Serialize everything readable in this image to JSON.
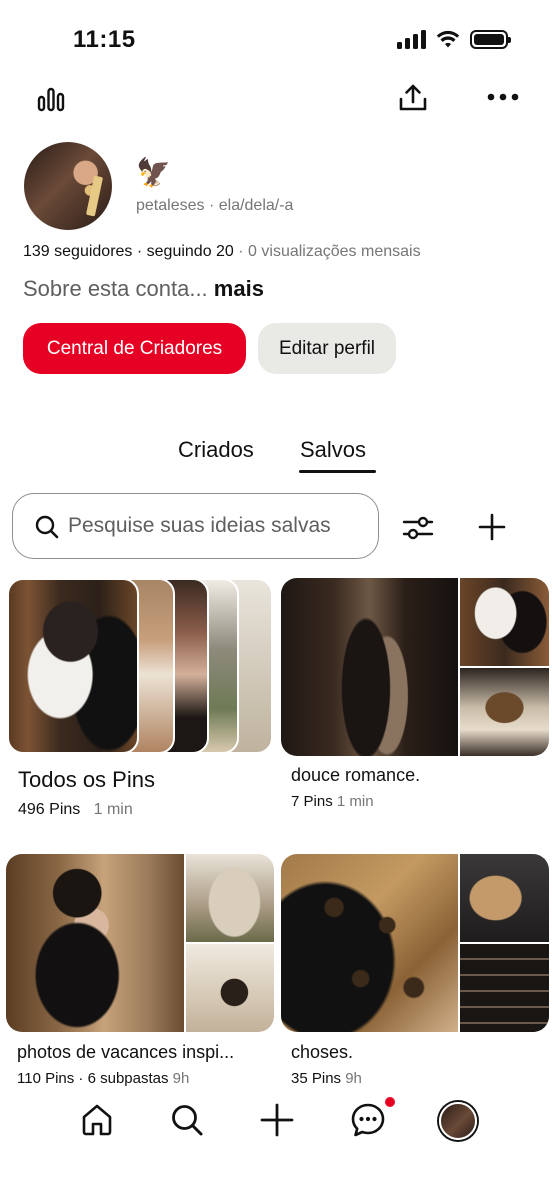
{
  "status_bar": {
    "time": "11:15"
  },
  "profile": {
    "emoji": "🦅",
    "username": "petaleses",
    "pronouns": "ela/dela/-a",
    "followers": "139 seguidores",
    "following": "seguindo 20",
    "monthly_views": "0 visualizações mensais",
    "about": "Sobre esta conta...",
    "about_more": "mais"
  },
  "buttons": {
    "creator_hub": "Central de Criadores",
    "edit_profile": "Editar perfil"
  },
  "tabs": [
    {
      "label": "Criados",
      "active": false
    },
    {
      "label": "Salvos",
      "active": true
    }
  ],
  "search": {
    "placeholder": "Pesquise suas ideias salvas"
  },
  "boards": [
    {
      "title": "Todos os Pins",
      "pins": "496 Pins",
      "updated": "1 min"
    },
    {
      "title": "douce romance.",
      "pins": "7 Pins",
      "updated": "1 min"
    },
    {
      "title": "photos de vacances inspi...",
      "pins": "110 Pins · 6 subpastas",
      "updated": "9h"
    },
    {
      "title": "choses.",
      "pins": "35 Pins",
      "updated": "9h"
    }
  ],
  "icons": {
    "analytics": "bar-chart-icon",
    "share": "share-icon",
    "more": "more-icon",
    "filter": "filter-icon",
    "add": "plus-icon"
  },
  "colors": {
    "accent": "#e60023",
    "secondary_button": "#e9e9e6",
    "muted_text": "#767676"
  }
}
